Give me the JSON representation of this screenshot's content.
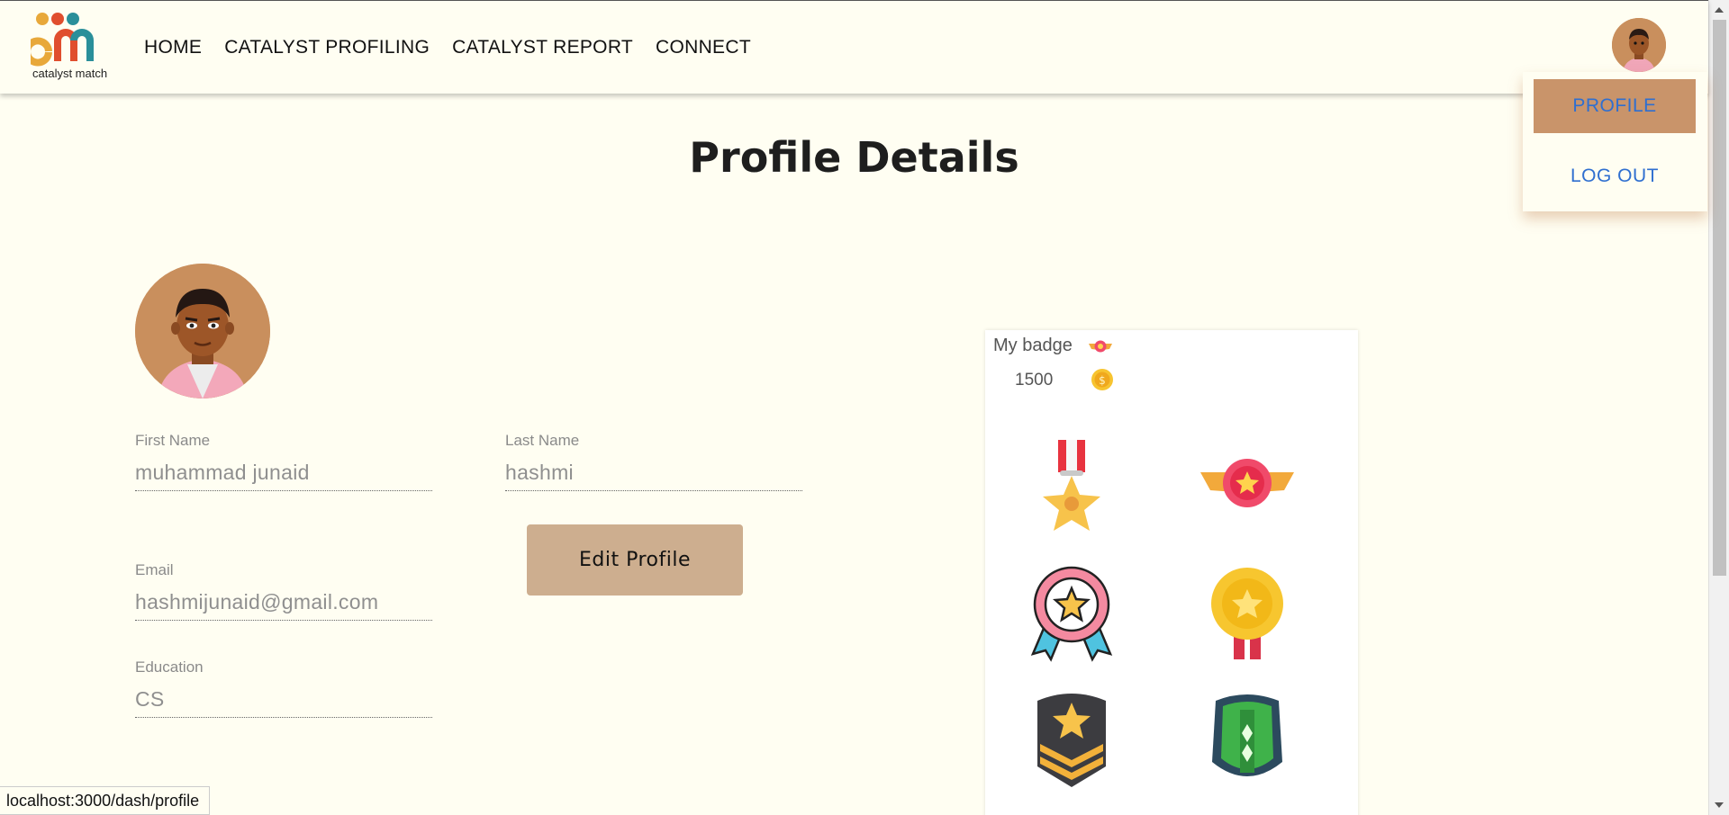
{
  "header": {
    "logo_alt_text": "catalyst match",
    "nav": [
      {
        "label": "HOME"
      },
      {
        "label": "CATALYST PROFILING"
      },
      {
        "label": "CATALYST REPORT"
      },
      {
        "label": "CONNECT"
      }
    ],
    "avatar_icon": "user-avatar-icon"
  },
  "dropdown": {
    "profile_label": "PROFILE",
    "logout_label": "LOG OUT"
  },
  "page": {
    "title": "Profile Details"
  },
  "profile": {
    "first_name_label": "First Name",
    "first_name_value": "muhammad junaid",
    "last_name_label": "Last Name",
    "last_name_value": "hashmi",
    "email_label": "Email",
    "email_value": "hashmijunaid@gmail.com",
    "education_label": "Education",
    "education_value": "CS",
    "edit_button_label": "Edit Profile"
  },
  "badges": {
    "title": "My badge",
    "coins": "1500",
    "items": [
      "star-medal-icon",
      "winged-medal-icon",
      "rosette-icon",
      "gold-medal-icon",
      "sergeant-chevron-icon",
      "green-shield-icon"
    ]
  },
  "status_bar": {
    "url": "localhost:3000/dash/profile"
  },
  "colors": {
    "background": "#fffef2",
    "dropdown_active": "#c9946a",
    "link_blue": "#2f6fd0",
    "edit_button": "#cdae8f"
  }
}
